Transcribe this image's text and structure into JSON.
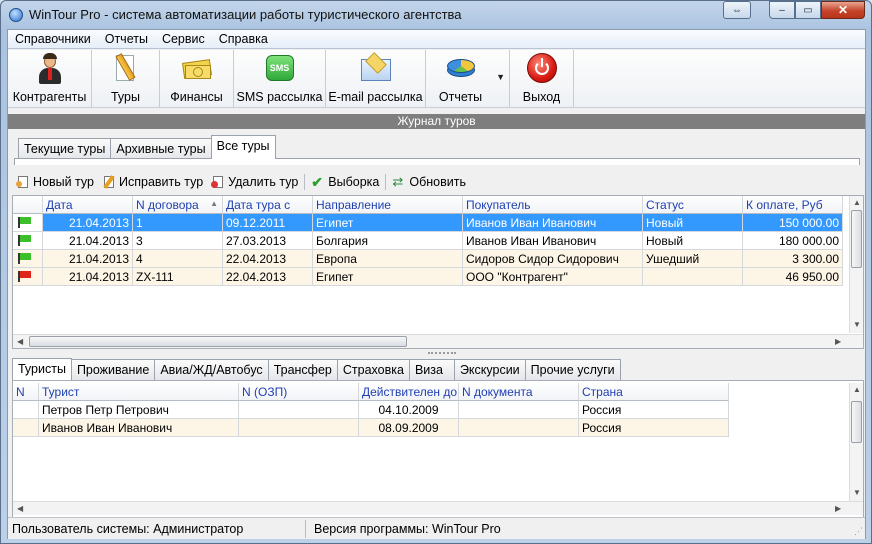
{
  "window": {
    "title": "WinTour Pro - система автоматизации работы туристического агентства",
    "close_glyph": "✕",
    "restore_glyph": "▭",
    "minimize_glyph": "–",
    "extra_glyph": "⇔"
  },
  "menu": [
    "Справочники",
    "Отчеты",
    "Сервис",
    "Справка"
  ],
  "toolbar": [
    {
      "label": "Контрагенты",
      "icon": "user-icon"
    },
    {
      "label": "Туры",
      "icon": "pencil-icon"
    },
    {
      "label": "Финансы",
      "icon": "money-icon"
    },
    {
      "label": "SMS рассылка",
      "icon": "sms-icon",
      "icon_text": "SMS"
    },
    {
      "label": "E-mail рассылка",
      "icon": "email-icon"
    },
    {
      "label": "Отчеты",
      "icon": "pie-chart-icon"
    },
    {
      "label": "Выход",
      "icon": "power-icon"
    }
  ],
  "journal_title": "Журнал туров",
  "top_tabs": [
    "Текущие туры",
    "Архивные туры",
    "Все туры"
  ],
  "top_active_tab": 2,
  "actions": [
    "Новый тур",
    "Исправить тур",
    "Удалить тур",
    "Выборка",
    "Обновить"
  ],
  "tours_grid": {
    "columns": [
      "Дата",
      "N договора",
      "Дата тура с",
      "Направление",
      "Покупатель",
      "Статус",
      "К оплате, Руб"
    ],
    "sort_glyph": "▲",
    "rows": [
      {
        "flag": "green",
        "date": "21.04.2013",
        "contract": "1",
        "tour_date": "09.12.2011",
        "direction": "Египет",
        "buyer": "Иванов Иван Иванович",
        "status": "Новый",
        "amount": "150 000.00",
        "selected": true
      },
      {
        "flag": "green",
        "date": "21.04.2013",
        "contract": "3",
        "tour_date": "27.03.2013",
        "direction": "Болгария",
        "buyer": "Иванов Иван Иванович",
        "status": "Новый",
        "amount": "180 000.00"
      },
      {
        "flag": "green",
        "date": "21.04.2013",
        "contract": "4",
        "tour_date": "22.04.2013",
        "direction": "Европа",
        "buyer": "Сидоров Сидор Сидорович",
        "status": "Ушедший",
        "amount": "3 300.00"
      },
      {
        "flag": "red",
        "date": "21.04.2013",
        "contract": "ZX-111",
        "tour_date": "22.04.2013",
        "direction": "Египет",
        "buyer": "ООО \"Контрагент\"",
        "status": "",
        "amount": "46 950.00"
      }
    ],
    "flag_colors": {
      "green": "#3bbf2a",
      "red": "#e02418"
    }
  },
  "bottom_tabs": [
    "Туристы",
    "Проживание",
    "Авиа/ЖД/Автобус",
    "Трансфер",
    "Страховка",
    "Виза",
    "Экскурсии",
    "Прочие услуги"
  ],
  "bottom_active_tab": 0,
  "tourists_grid": {
    "columns": [
      "N",
      "Турист",
      "N (ОЗП)",
      "Действителен до",
      "N документа",
      "Страна"
    ],
    "rows": [
      {
        "n": "",
        "name": "Петров Петр Петрович",
        "ozp": "",
        "valid": "04.10.2009",
        "doc": "",
        "country": "Россия"
      },
      {
        "n": "",
        "name": "Иванов Иван Иванович",
        "ozp": "",
        "valid": "08.09.2009",
        "doc": "",
        "country": "Россия"
      }
    ]
  },
  "status": {
    "user": "Пользователь системы: Администратор",
    "version": "Версия программы: WinTour Pro"
  }
}
